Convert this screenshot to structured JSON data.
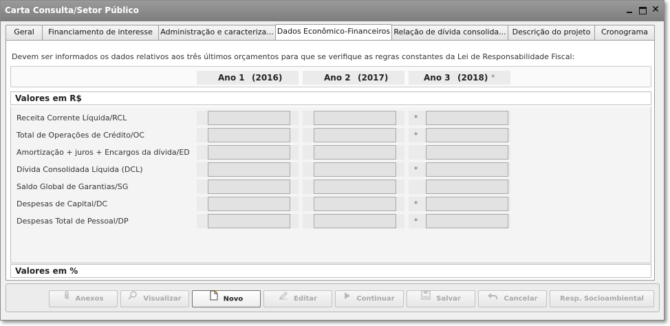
{
  "window": {
    "title": "Carta Consulta/Setor Público"
  },
  "tabs": [
    {
      "label": "Geral"
    },
    {
      "label": "Financiamento de interesse"
    },
    {
      "label": "Administração e caracteriza..."
    },
    {
      "label": "Dados Econômico-Financeiros"
    },
    {
      "label": "Relação de dívida consolida..."
    },
    {
      "label": "Descrição do projeto"
    },
    {
      "label": "Cronograma"
    }
  ],
  "intro": "Devem ser informados os dados relativos aos três últimos orçamentos para que se verifique as regras constantes da Lei de Responsabilidade Fiscal:",
  "years": [
    {
      "label": "Ano 1",
      "year": "(2016)",
      "mark": ""
    },
    {
      "label": "Ano 2",
      "year": "(2017)",
      "mark": ""
    },
    {
      "label": "Ano 3",
      "year": "(2018)",
      "mark": "*"
    }
  ],
  "sections": {
    "reais": "Valores em R$",
    "percent": "Valores em %"
  },
  "rows": [
    {
      "label": "Receita Corrente Líquida/RCL",
      "values": [
        "",
        "",
        ""
      ],
      "required": "*"
    },
    {
      "label": "Total de Operações de Crédito/OC",
      "values": [
        "",
        "",
        ""
      ],
      "required": "*"
    },
    {
      "label": "Amortização + juros + Encargos da dívida/ED",
      "values": [
        "",
        "",
        ""
      ],
      "required": ""
    },
    {
      "label": "Dívida Consolidada Líquida (DCL)",
      "values": [
        "",
        "",
        ""
      ],
      "required": "*"
    },
    {
      "label": "Saldo Global de Garantias/SG",
      "values": [
        "",
        "",
        ""
      ],
      "required": ""
    },
    {
      "label": "Despesas de Capital/DC",
      "values": [
        "",
        "",
        ""
      ],
      "required": "*"
    },
    {
      "label": "Despesas Total de Pessoal/DP",
      "values": [
        "",
        "",
        ""
      ],
      "required": "*"
    }
  ],
  "buttons": {
    "anexos": "Anexos",
    "visualizar": "Visualizar",
    "novo": "Novo",
    "editar": "Editar",
    "continuar": "Continuar",
    "salvar": "Salvar",
    "cancelar": "Cancelar",
    "resp": "Resp. Socioambiental"
  },
  "icons": {
    "anexos": "paperclip-icon",
    "visualizar": "magnifier-icon",
    "novo": "new-document-icon",
    "editar": "pencil-icon",
    "continuar": "play-icon",
    "salvar": "floppy-icon",
    "cancelar": "undo-icon"
  }
}
